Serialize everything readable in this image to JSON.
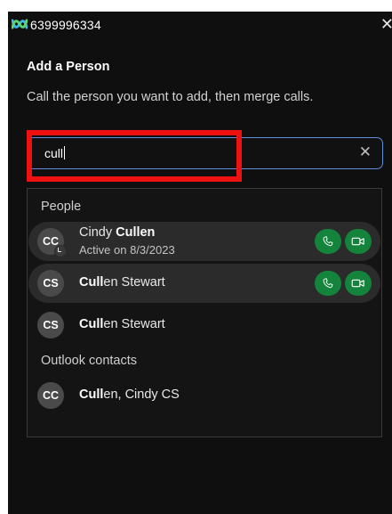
{
  "window": {
    "title": "6399996334",
    "close_glyph": "✕",
    "app_icon": "webex-logo-icon"
  },
  "dialog": {
    "heading": "Add a Person",
    "description": "Call the person you want to add, then merge calls."
  },
  "search": {
    "value": "cull",
    "clear_glyph": "✕"
  },
  "results": {
    "people_label": "People",
    "people": [
      {
        "initials": "CC",
        "name_plain": "Cindy ",
        "name_bold": "Cullen",
        "name_rest": "",
        "status": "Active on 8/3/2023",
        "has_status_icon": true,
        "actions": [
          "audio-call",
          "video-call"
        ]
      },
      {
        "initials": "CS",
        "name_plain": "",
        "name_bold": "Cull",
        "name_rest": "en Stewart",
        "actions": [
          "audio-call",
          "video-call"
        ]
      },
      {
        "initials": "CS",
        "name_plain": "",
        "name_bold": "Cull",
        "name_rest": "en Stewart"
      }
    ],
    "outlook_label": "Outlook contacts",
    "outlook": [
      {
        "initials": "CC",
        "name_plain": "",
        "name_bold": "Cull",
        "name_rest": "en, Cindy CS"
      }
    ]
  },
  "colors": {
    "background": "#0f0f0f",
    "accent_green": "#14843c",
    "focus_border": "#5e8ddb",
    "annotation_red": "#ee1111"
  }
}
